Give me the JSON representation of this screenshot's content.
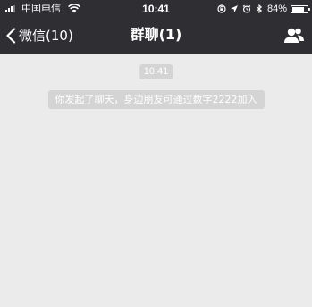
{
  "status_bar": {
    "carrier": "中国电信",
    "time": "10:41",
    "battery": "84%",
    "battery_level": 0.84,
    "icons": [
      "signal-icon",
      "wifi-icon",
      "orientation-lock-icon",
      "location-arrow-icon",
      "alarm-icon",
      "bluetooth-icon",
      "battery-icon"
    ]
  },
  "nav": {
    "back_label": "微信(10)",
    "title": "群聊(1)",
    "right_icon": "group-contacts-icon"
  },
  "chat": {
    "timestamp": "10:41",
    "system_message": "你发起了聊天，身边朋友可通过数字2222加入"
  },
  "colors": {
    "header_bg": "#2e2e33",
    "chat_bg": "#ebebeb",
    "pill_bg": "#d4d4d4",
    "text_on_dark": "#ffffff"
  }
}
